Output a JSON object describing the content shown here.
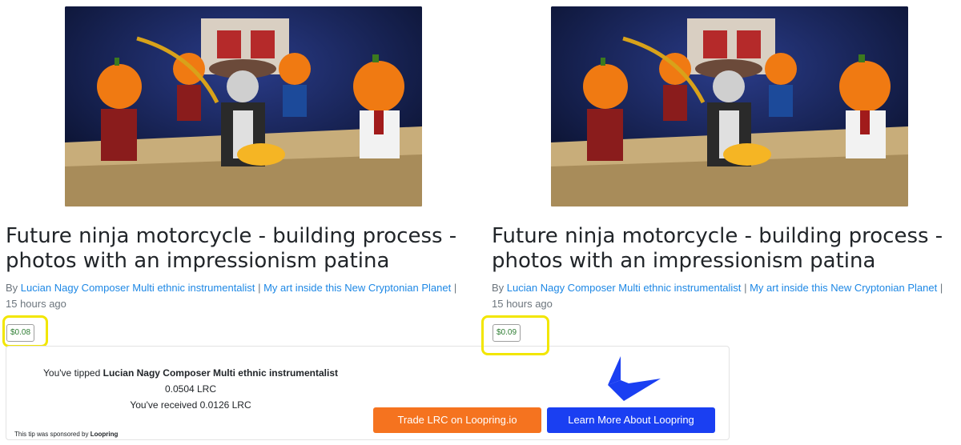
{
  "colors": {
    "link": "#1e88e5",
    "price_text": "#2e7d32",
    "highlight": "#f2e600",
    "trade_button": "#f5731f",
    "learn_button": "#1a3ff2",
    "loopring_logo": "#1a3ff2"
  },
  "posts": [
    {
      "title": "Future ninja motorcycle - building process - photos with an impressionism patina",
      "by_label": "By",
      "author": "Lucian Nagy Composer Multi ethnic instrumentalist",
      "sep1": "|",
      "community": "My art inside this New Cryptonian Planet",
      "sep2": "|",
      "time": "15 hours ago",
      "price": "$0.08"
    },
    {
      "title": "Future ninja motorcycle - building process - photos with an impressionism patina",
      "by_label": "By",
      "author": "Lucian Nagy Composer Multi ethnic instrumentalist",
      "sep1": "|",
      "community": "My art inside this New Cryptonian Planet",
      "sep2": "|",
      "time": "15 hours ago",
      "price": "$0.09"
    }
  ],
  "tip": {
    "prefix": "You've tipped",
    "recipient": "Lucian Nagy Composer Multi ethnic instrumentalist",
    "amount": "0.0504 LRC",
    "received": "You've received 0.0126 LRC",
    "sponsor_prefix": "This tip was sponsored by",
    "sponsor_name": "Loopring",
    "trade_button": "Trade LRC on Loopring.io",
    "learn_button": "Learn More About Loopring",
    "logo_icon": "loopring-logo-icon"
  }
}
